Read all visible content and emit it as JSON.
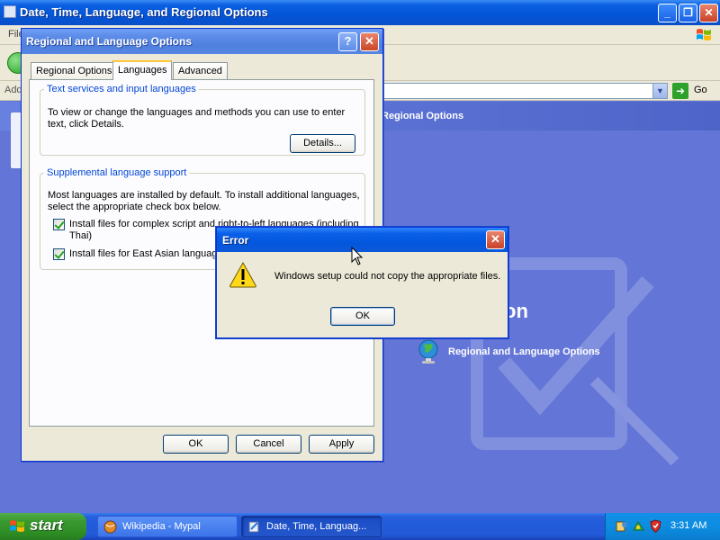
{
  "explorer": {
    "title": "Date, Time, Language, and Regional Options",
    "menu_partial": "File",
    "address_label_partial": "Add",
    "go_label": "Go",
    "band_text": "Regional Options",
    "heading_partial": "on",
    "task_label": "Regional and Language Options"
  },
  "rlo": {
    "title": "Regional and Language Options",
    "help_glyph": "?",
    "close_glyph": "✕",
    "tabs": [
      {
        "label": "Regional Options",
        "selected": false
      },
      {
        "label": "Languages",
        "selected": true
      },
      {
        "label": "Advanced",
        "selected": false
      }
    ],
    "text_services": {
      "legend": "Text services and input languages",
      "description_line1": "To view or change the languages and methods you can use to enter",
      "description_line2": "text, click Details.",
      "details_button": "Details..."
    },
    "supplemental": {
      "legend": "Supplemental language support",
      "description_line1": "Most languages are installed by default. To install additional languages,",
      "description_line2": "select the appropriate check box below.",
      "checkbox_complex_line1": "Install files for complex script and right-to-left languages (including",
      "checkbox_complex_line2": "Thai)",
      "checkbox_complex_checked": true,
      "checkbox_east_asian": "Install files for East Asian languages",
      "checkbox_east_asian_checked": true
    },
    "buttons": {
      "ok": "OK",
      "cancel": "Cancel",
      "apply": "Apply"
    }
  },
  "error": {
    "title": "Error",
    "close_glyph": "✕",
    "message": "Windows setup could not copy the appropriate files.",
    "ok": "OK"
  },
  "taskbar": {
    "start_label": "start",
    "tasks": [
      {
        "label": "Wikipedia - Mypal",
        "active": false
      },
      {
        "label": "Date, Time, Languag...",
        "active": true
      }
    ],
    "clock": "3:31 AM"
  },
  "colors": {
    "desktop_blue": "#6375d6",
    "title_blue": "#0a5fe0",
    "dialog_face": "#ece9d8",
    "legend_blue": "#0046d5",
    "start_green": "#3a9a30"
  },
  "icons": [
    "xp-logo-icon",
    "back-arrow-icon",
    "go-arrow-icon",
    "globe-icon",
    "warning-icon",
    "windows-flag-icon",
    "browser-icon",
    "control-panel-icon",
    "tray-icon",
    "shield-icon",
    "mouse-cursor-icon"
  ]
}
